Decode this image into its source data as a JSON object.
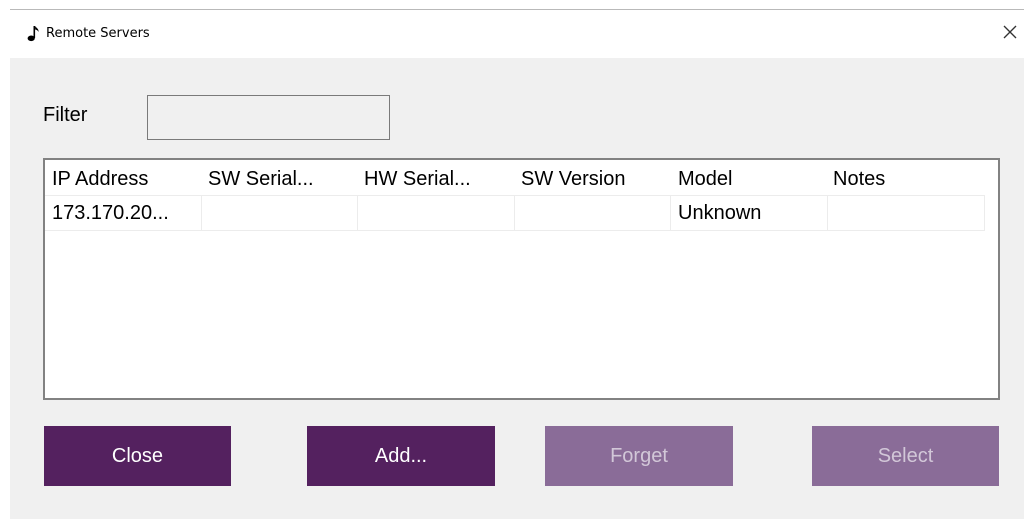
{
  "window": {
    "title": "Remote Servers",
    "app_icon": "music-note-icon",
    "close_icon": "close-icon",
    "close_glyph": "✕"
  },
  "filter": {
    "label": "Filter",
    "value": ""
  },
  "list": {
    "columns": [
      "IP Address",
      "SW Serial...",
      "HW Serial...",
      "SW Version",
      "Model",
      "Notes"
    ],
    "rows": [
      [
        "173.170.20...",
        "",
        "",
        "",
        "Unknown",
        ""
      ]
    ]
  },
  "buttons": {
    "close": "Close",
    "add": "Add...",
    "forget": "Forget",
    "select": "Select"
  },
  "colors": {
    "accent": "#54215f",
    "accent_disabled": "#8a6c98",
    "background": "#f0f0f0"
  }
}
